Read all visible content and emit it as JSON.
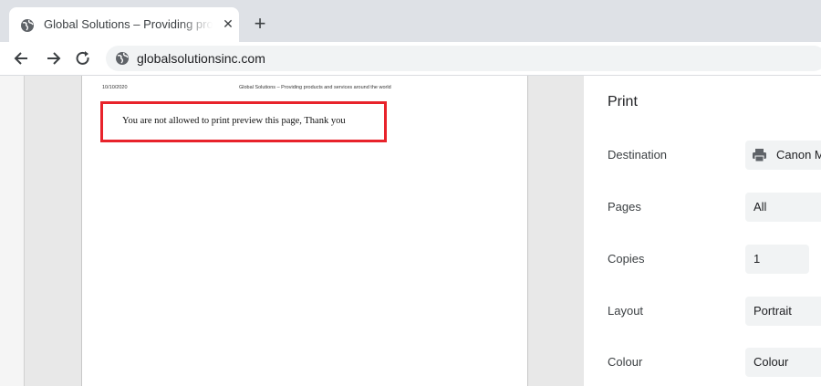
{
  "tab": {
    "title": "Global Solutions – Providing prod",
    "close_glyph": "✕",
    "favicon": "globe-icon"
  },
  "new_tab_glyph": "+",
  "toolbar": {
    "url": "globalsolutionsinc.com",
    "back_icon": "arrow-left-icon",
    "forward_icon": "arrow-right-icon",
    "reload_icon": "reload-icon"
  },
  "preview": {
    "header_date": "10/10/2020",
    "header_title": "Global Solutions – Providing products and services around the world",
    "message": "You are not allowed to print preview this page, Thank you",
    "highlight_color": "#e8232b"
  },
  "print_panel": {
    "title": "Print",
    "settings": [
      {
        "label": "Destination",
        "value": "Canon M"
      },
      {
        "label": "Pages",
        "value": "All"
      },
      {
        "label": "Copies",
        "value": "1"
      },
      {
        "label": "Layout",
        "value": "Portrait"
      },
      {
        "label": "Colour",
        "value": "Colour"
      }
    ]
  }
}
